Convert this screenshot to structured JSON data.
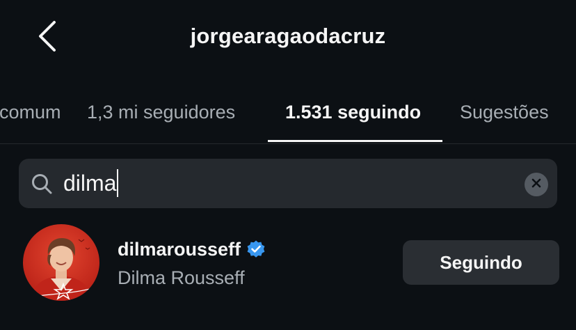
{
  "header": {
    "title": "jorgearagaodacruz",
    "back_icon": "chevron-left-icon"
  },
  "tabs": [
    {
      "label": "Em comum"
    },
    {
      "label": "1,3 mi seguidores"
    },
    {
      "label": "1.531 seguindo",
      "active": true
    },
    {
      "label": "Sugestões"
    }
  ],
  "search": {
    "value": "dilma",
    "icon": "search-icon",
    "clear_icon": "clear-icon"
  },
  "results": [
    {
      "username": "dilmarousseff",
      "full_name": "Dilma Rousseff",
      "verified": true,
      "button_label": "Seguindo"
    }
  ],
  "colors": {
    "background": "#0c1014",
    "text_primary": "#f5f5f5",
    "text_secondary": "#a8aeb4",
    "search_bg": "#25292e",
    "button_bg": "#2a2e33",
    "verified_blue": "#3897f0",
    "avatar_red": "#c92a1e"
  }
}
